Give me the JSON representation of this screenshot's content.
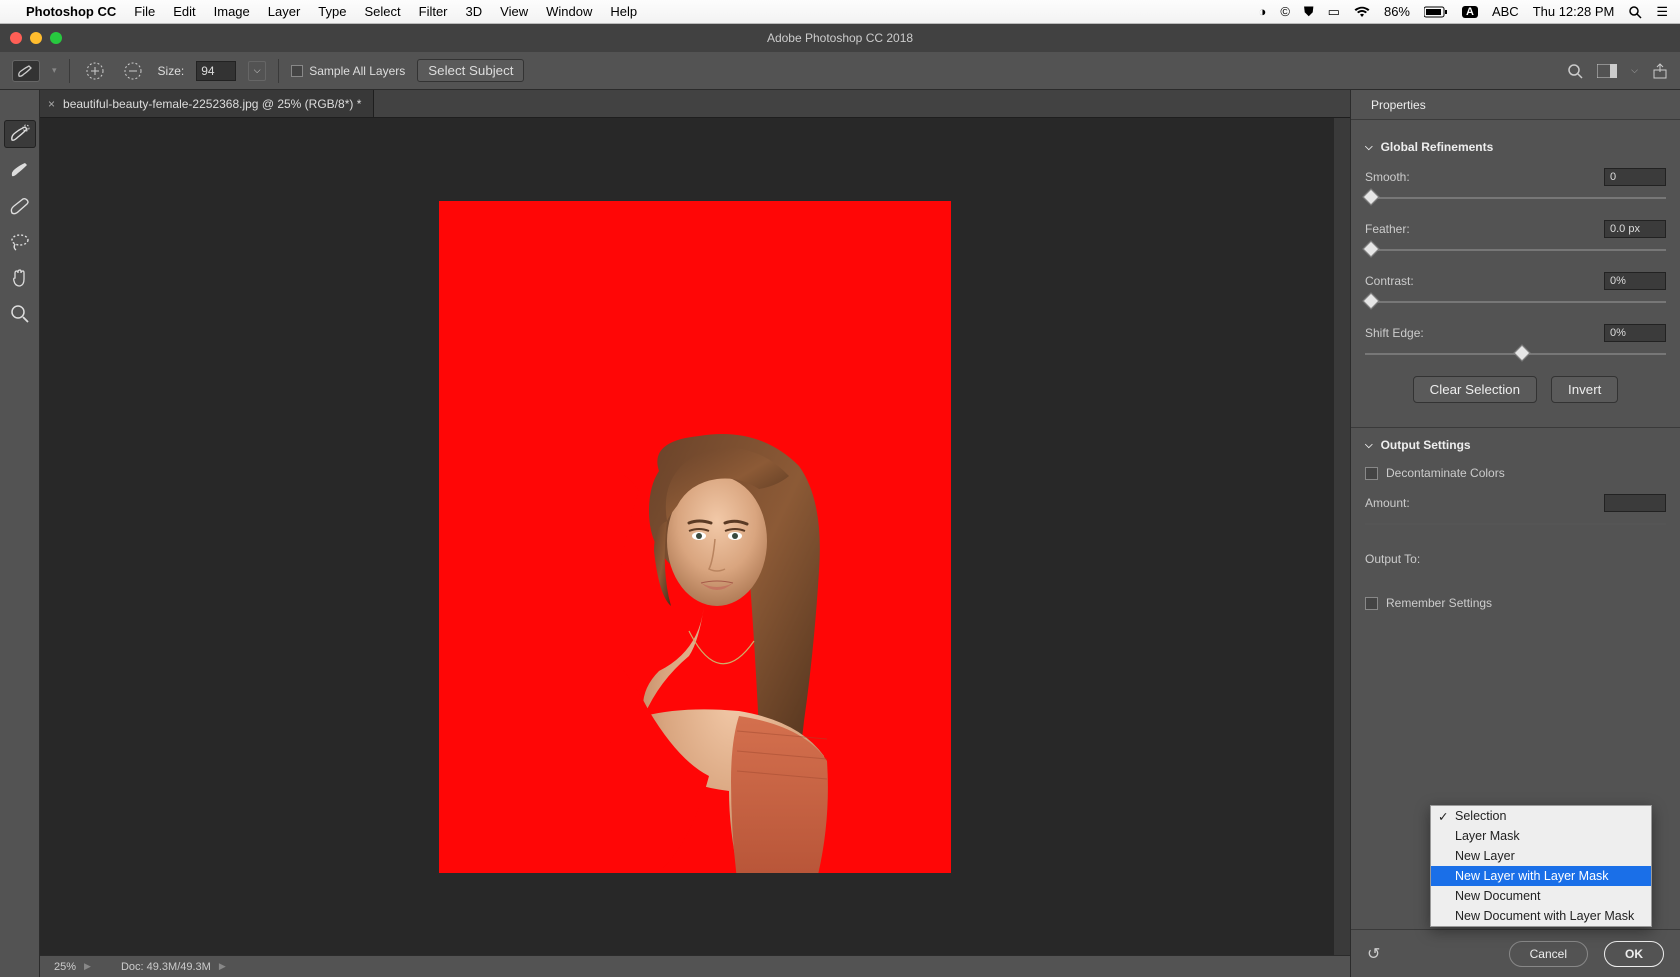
{
  "mac_menu": {
    "app_name": "Photoshop CC",
    "items": [
      "File",
      "Edit",
      "Image",
      "Layer",
      "Type",
      "Select",
      "Filter",
      "3D",
      "View",
      "Window",
      "Help"
    ],
    "battery_pct": "86%",
    "input_badge": "A",
    "input_label": "ABC",
    "clock": "Thu 12:28 PM"
  },
  "window_title": "Adobe Photoshop CC 2018",
  "options": {
    "size_label": "Size:",
    "size_value": "94",
    "sample_all_label": "Sample All Layers",
    "select_subject_label": "Select Subject"
  },
  "doc_tab": {
    "label": "beautiful-beauty-female-2252368.jpg @ 25% (RGB/8*) *"
  },
  "status": {
    "zoom": "25%",
    "doc_info": "Doc: 49.3M/49.3M"
  },
  "props": {
    "panel_tab": "Properties",
    "section_global": "Global Refinements",
    "smooth_label": "Smooth:",
    "smooth_value": "0",
    "feather_label": "Feather:",
    "feather_value": "0.0 px",
    "contrast_label": "Contrast:",
    "contrast_value": "0%",
    "shift_label": "Shift Edge:",
    "shift_value": "0%",
    "clear_btn": "Clear Selection",
    "invert_btn": "Invert",
    "section_output": "Output Settings",
    "decontaminate_label": "Decontaminate Colors",
    "amount_label": "Amount:",
    "output_to_label": "Output To:",
    "remember_label": "Remember Settings",
    "cancel": "Cancel",
    "ok": "OK"
  },
  "dropdown": {
    "options": [
      "Selection",
      "Layer Mask",
      "New Layer",
      "New Layer with Layer Mask",
      "New Document",
      "New Document with Layer Mask"
    ],
    "checked_index": 0,
    "highlight_index": 3
  }
}
